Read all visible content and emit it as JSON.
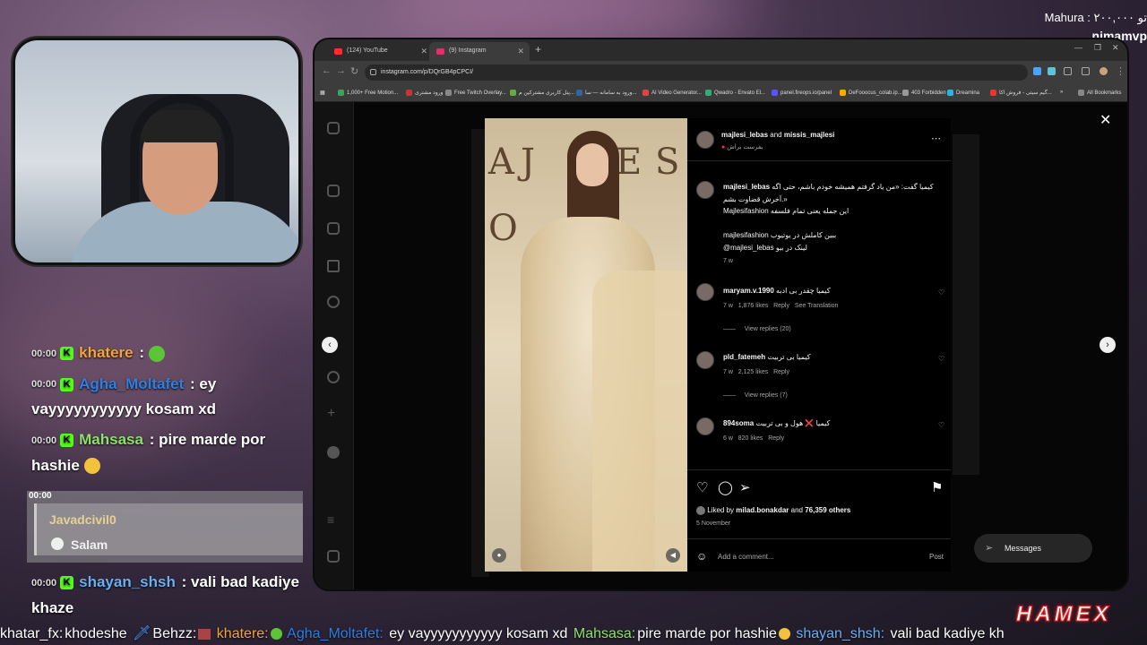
{
  "overlay": {
    "top_right_line1": "Mahura : ۲۰۰,۰۰۰ تو",
    "top_right_line2": "nimamvp",
    "logo": "HAMEX"
  },
  "chat": {
    "messages": [
      {
        "ts": "00:00",
        "user": "khatere",
        "sep": ":",
        "text": "",
        "color": "#f2a33a"
      },
      {
        "ts": "00:00",
        "user": "Agha_Moltafet",
        "sep": ":",
        "text": "ey vayyyyyyyyyyy kosam xd",
        "color": "#2d7fe0"
      },
      {
        "ts": "00:00",
        "user": "Mahsasa",
        "sep": ":",
        "text": "pire marde por hashie",
        "color": "#8ee06a"
      },
      {
        "ts": "00:00",
        "user": "shayan_shsh",
        "sep": ":",
        "text": "vali bad kadiye khaze",
        "color": "#6aaef0"
      }
    ],
    "embed": {
      "ts": "00:00",
      "name": "Javadcivil0",
      "text": "Salam"
    }
  },
  "ticker": [
    {
      "user": "khatar_fx:",
      "text": "khodeshe",
      "color": "#dddddd"
    },
    {
      "user": "Behzz:",
      "text": "",
      "color": "#dddddd"
    },
    {
      "user": "khatere:",
      "text": "",
      "color": "#f2a33a"
    },
    {
      "user": "Agha_Moltafet:",
      "text": "ey vayyyyyyyyyyy kosam xd",
      "color": "#2d7fe0"
    },
    {
      "user": "Mahsasa:",
      "text": "pire marde por hashie",
      "color": "#8ee06a"
    },
    {
      "user": "shayan_shsh:",
      "text": "vali bad kadiye khaze",
      "color": "#6aaef0"
    }
  ],
  "browser": {
    "tabs": [
      {
        "label": "(124) YouTube",
        "color": "#ff2d2d"
      },
      {
        "label": "(9) Instagram",
        "color": "#e1306c"
      }
    ],
    "url": "instagram.com/p/DQrGB4pCPCI/",
    "bookmarks": [
      "1,000+ Free Motion...",
      "ورود مشتری",
      "Free Twitch Overlay...",
      "پنل کاربری مشترکین م...",
      "ورود به سامانه — سا...",
      "AI Video Generator...",
      "Qwadro - Envato El...",
      "panel.fireops.io/panel",
      "DeFooocus_colab.ip...",
      "403 Forbidden",
      "Dreamina",
      "گیم سیتی - فروش اکا..."
    ],
    "all_bookmarks": "All Bookmarks"
  },
  "post": {
    "header_users": "majlesi_lebas",
    "header_and": "and",
    "header_user2": "missis_majlesi",
    "header_sub": "بفرست براش",
    "caption_user": "majlesi_lebas",
    "caption_line1": "کیمیا گفت: «من یاد گرفتم همیشه خودم باشم، حتی اگه",
    "caption_line2": "آخرش قضاوت بشم.»",
    "caption_line3": "Majlesifashion این جمله یعنی تمام فلسفه",
    "caption_line4": "majlesifashion ببین کاملش در یوتیوب",
    "caption_line5": "@majlesi_lebas لینک در بیو",
    "caption_time": "7 w",
    "comments": [
      {
        "user": "maryam.v.1990",
        "text": "کیمیا چقدر بی ادبه",
        "time": "7 w",
        "likes": "1,876 likes",
        "reply": "Reply",
        "extra": "See Translation",
        "replies": "View replies (20)"
      },
      {
        "user": "pld_fatemeh",
        "text": "کیمیا بی تربیت",
        "time": "7 w",
        "likes": "2,125 likes",
        "reply": "Reply",
        "extra": "",
        "replies": "View replies (7)"
      },
      {
        "user": "894soma",
        "text": "کیمیا ❌ هول و بی تربیت",
        "time": "6 w",
        "likes": "820 likes",
        "reply": "Reply",
        "extra": "",
        "replies": ""
      }
    ],
    "liked_prefix": "Liked by",
    "liked_user": "milad.bonakdar",
    "liked_and": "and",
    "liked_count": "76,359 others",
    "date": "5 November",
    "add_comment_placeholder": "Add a comment...",
    "post_label": "Post",
    "messages_label": "Messages"
  }
}
